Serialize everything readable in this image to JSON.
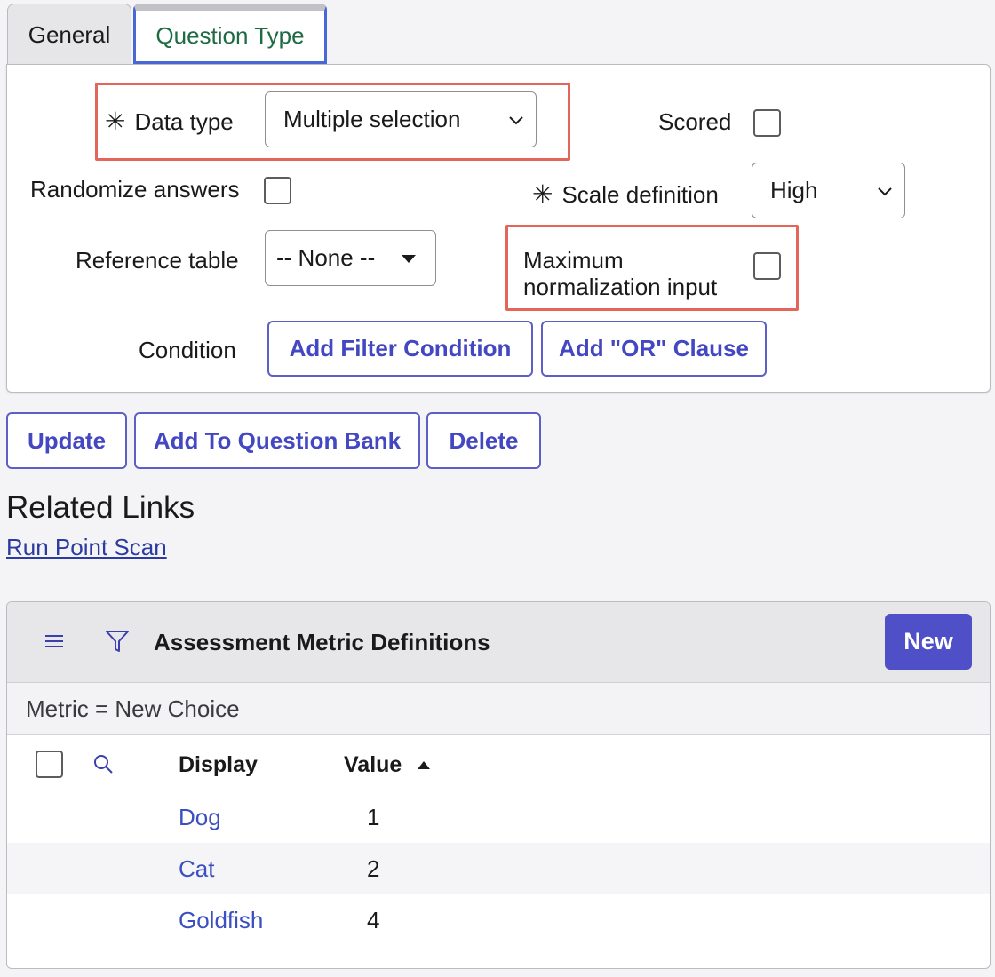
{
  "tabs": [
    {
      "label": "General"
    },
    {
      "label": "Question Type"
    }
  ],
  "form": {
    "data_type": {
      "label": "Data type",
      "value": "Multiple selection"
    },
    "scored": {
      "label": "Scored"
    },
    "randomize": {
      "label": "Randomize answers"
    },
    "scale_definition": {
      "label": "Scale definition",
      "value": "High"
    },
    "reference_table": {
      "label": "Reference table",
      "value": "-- None --"
    },
    "max_norm": {
      "label_line1": "Maximum",
      "label_line2": "normalization input"
    },
    "condition": {
      "label": "Condition",
      "add_filter": "Add Filter Condition",
      "add_or": "Add \"OR\" Clause"
    }
  },
  "actions": {
    "update": "Update",
    "add_to_bank": "Add To Question Bank",
    "delete": "Delete"
  },
  "related_links": {
    "title": "Related Links",
    "run_point_scan": "Run Point Scan"
  },
  "related_list": {
    "title": "Assessment Metric Definitions",
    "new_label": "New",
    "filter": "Metric = New Choice",
    "columns": {
      "display": "Display",
      "value": "Value"
    },
    "rows": [
      {
        "display": "Dog",
        "value": "1"
      },
      {
        "display": "Cat",
        "value": "2"
      },
      {
        "display": "Goldfish",
        "value": "4"
      }
    ]
  },
  "colors": {
    "accent": "#4f4fc8",
    "link": "#3c4fc0",
    "highlight": "#e4665b",
    "active_tab_text": "#1f6b43"
  }
}
